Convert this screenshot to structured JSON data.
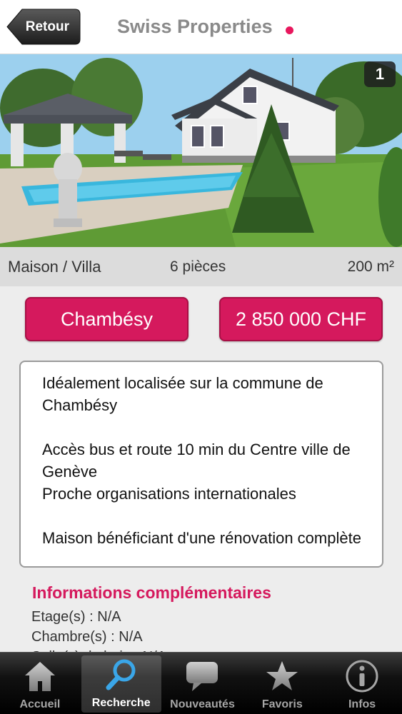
{
  "navbar": {
    "back_label": "Retour",
    "title": "Swiss Properties"
  },
  "photo": {
    "counter": "1"
  },
  "strip": {
    "type": "Maison / Villa",
    "rooms": "6 pièces",
    "area": "200 m²"
  },
  "buttons": {
    "city": "Chambésy",
    "price": "2 850 000 CHF"
  },
  "description": {
    "p1": "Idéalement localisée sur la commune de Chambésy",
    "p2a": "Accès bus et route 10 min du Centre ville de Genève",
    "p2b": "Proche organisations internationales",
    "p3": "Maison bénéficiant d'une rénovation complète"
  },
  "extra": {
    "title": "Informations complémentaires",
    "line1": "Etage(s) : N/A",
    "line2": "Chambre(s) : N/A",
    "line3": "Salle(s) de bain : N/A"
  },
  "tabbar": {
    "tabs": [
      {
        "label": "Accueil",
        "icon": "home-icon"
      },
      {
        "label": "Recherche",
        "icon": "search-icon"
      },
      {
        "label": "Nouveautés",
        "icon": "speech-bubble-icon"
      },
      {
        "label": "Favoris",
        "icon": "star-icon"
      },
      {
        "label": "Infos",
        "icon": "info-icon"
      }
    ]
  },
  "colors": {
    "accent": "#d5195d",
    "nav_dot": "#e8175d",
    "title_gray": "#8a8a8a"
  }
}
